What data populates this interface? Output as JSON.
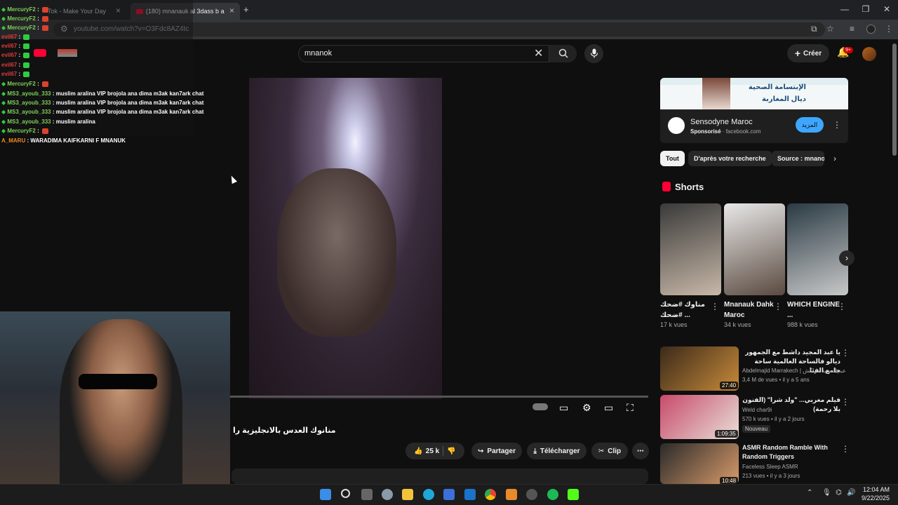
{
  "browser": {
    "tabs": [
      {
        "label": "Tok - Make Your Day"
      },
      {
        "label": "(180) mnanauk al 3dass b a"
      }
    ],
    "url": "youtube.com/watch?v=O3Fdc8AZ4tc",
    "new_tab_glyph": "+",
    "minimize_glyph": "—",
    "restore_glyph": "❐",
    "close_glyph": "✕"
  },
  "youtube": {
    "search_value": "mnanok",
    "create_label": "Créer",
    "notification_count": "9+",
    "video_title": "منانوك العدس بالانجليزية را",
    "like_count": "25 k",
    "share_label": "Partager",
    "download_label": "Télécharger",
    "clip_label": "Clip"
  },
  "ad": {
    "banner_line1": "الإبتسامة الصحية",
    "banner_line2": "ديال المغاربة",
    "advertiser": "Sensodyne Maroc",
    "sponsored": "Sponsorisé",
    "domain": "facebook.com",
    "cta": "المزيد"
  },
  "chips": [
    {
      "label": "Tout"
    },
    {
      "label": "D'après votre recherche"
    },
    {
      "label": "Source : mnanok"
    }
  ],
  "shorts": {
    "title": "Shorts",
    "items": [
      {
        "title": "مناوك #ضحك #ضحك ...",
        "views": "17 k vues",
        "color1": "#3a3a3a",
        "color2": "#c8b8a8"
      },
      {
        "title": "Mnanauk Dahk Maroc",
        "views": "34 k vues",
        "color1": "#e8e8e8",
        "color2": "#5a4a40"
      },
      {
        "title": "WHICH ENGINE ...",
        "views": "988 k vues",
        "color1": "#2a3a44",
        "color2": "#c8c8c8"
      }
    ]
  },
  "recommended": [
    {
      "title": "يا عبد المجيد داشط مع الجمهور ديالو فالساحة العالمية ساحة جامع الفنا",
      "channel": "Abdelmajid Marrakech | عبد المجيد مراكش",
      "meta": "3,4 M de vues • il y a 5 ans",
      "duration": "27:40",
      "badge": "",
      "color1": "#3a2a1a",
      "color2": "#c88a3a"
    },
    {
      "title": "فيلم مغربي... \"ولد شرا\" (الفنون بلا رحمة)",
      "channel": "Weld char9i",
      "meta": "570 k vues • il y a 2 jours",
      "duration": "1:09:35",
      "badge": "Nouveau",
      "color1": "#c84a6a",
      "color2": "#e8e0d8"
    },
    {
      "title": "ASMR Random Ramble With Random Triggers",
      "channel": "Faceless Sleep ASMR",
      "meta": "213 vues • il y a 3 jours",
      "duration": "10:48",
      "badge": "",
      "color1": "#2a2a2a",
      "color2": "#d89a6a"
    }
  ],
  "chat": [
    {
      "user": "MercuryF2",
      "msg": "",
      "user_color": "green",
      "emote": "red"
    },
    {
      "user": "MercuryF2",
      "msg": "",
      "user_color": "green",
      "emote": "red"
    },
    {
      "user": "MercuryF2",
      "msg": "",
      "user_color": "green",
      "emote": "red"
    },
    {
      "user": "evil67",
      "msg": "",
      "user_color": "red",
      "emote": "green"
    },
    {
      "user": "evil67",
      "msg": "",
      "user_color": "red",
      "emote": "green"
    },
    {
      "user": "evil67",
      "msg": "",
      "user_color": "red",
      "emote": "green"
    },
    {
      "user": "evil67",
      "msg": "",
      "user_color": "red",
      "emote": "green"
    },
    {
      "user": "evil67",
      "msg": "",
      "user_color": "red",
      "emote": "green"
    },
    {
      "user": "MercuryF2",
      "msg": "",
      "user_color": "green",
      "emote": "red"
    },
    {
      "user": "MS3_ayoub_333",
      "msg": "muslim aralina VIP brojola ana dima m3ak kan7ark chat",
      "user_color": "green",
      "emote": ""
    },
    {
      "user": "MS3_ayoub_333",
      "msg": "muslim aralina VIP brojola ana dima m3ak kan7ark chat",
      "user_color": "green",
      "emote": ""
    },
    {
      "user": "MS3_ayoub_333",
      "msg": "muslim aralina VIP brojola ana dima m3ak kan7ark chat",
      "user_color": "green",
      "emote": ""
    },
    {
      "user": "MS3_ayoub_333",
      "msg": "muslim aralina",
      "user_color": "green",
      "emote": ""
    },
    {
      "user": "MercuryF2",
      "msg": "",
      "user_color": "green",
      "emote": "red"
    },
    {
      "user": "A_MARU",
      "msg": "WARADIMA KAIFKARNI F MNANUK",
      "user_color": "orange",
      "emote": ""
    }
  ],
  "taskbar": {
    "time": "12:04 AM",
    "date": "9/22/2025"
  },
  "colors": {
    "accent_blue": "#3ea6ff",
    "yt_red": "#ff0033",
    "notif_red": "#cc0000"
  }
}
